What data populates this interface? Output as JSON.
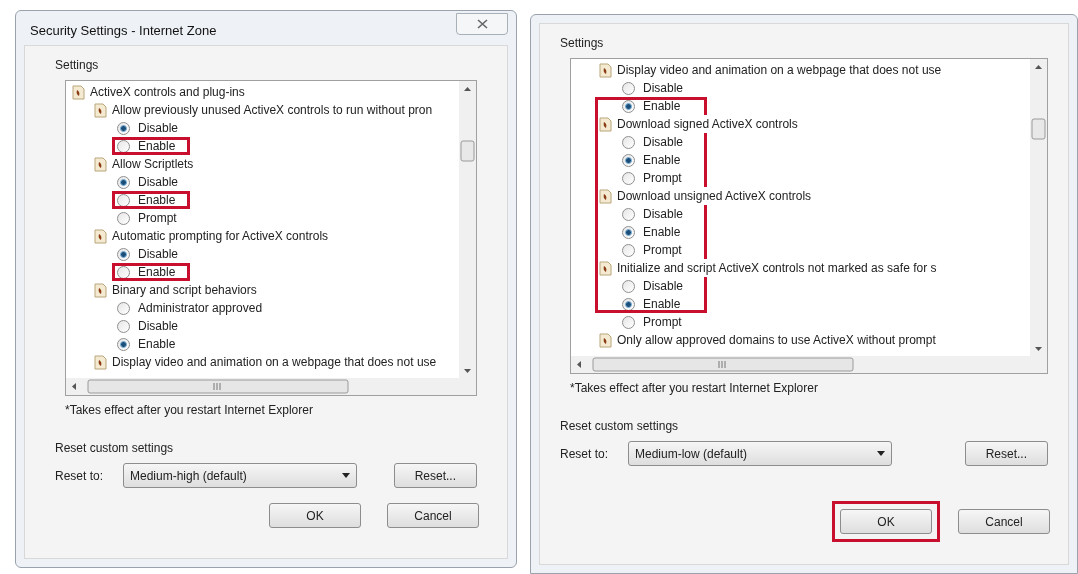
{
  "dialogs": [
    {
      "title": "Security Settings - Internet Zone",
      "settings": {
        "heading": "Settings",
        "tree": [
          {
            "label": "ActiveX controls and plug-ins",
            "highlighted": false,
            "children": [
              {
                "label": "Allow previously unused ActiveX controls to run without pron",
                "highlighted": false,
                "options": [
                  {
                    "label": "Disable",
                    "selected": true,
                    "highlighted": false
                  },
                  {
                    "label": "Enable",
                    "selected": false,
                    "highlighted": true
                  }
                ]
              },
              {
                "label": "Allow Scriptlets",
                "highlighted": false,
                "options": [
                  {
                    "label": "Disable",
                    "selected": true,
                    "highlighted": false
                  },
                  {
                    "label": "Enable",
                    "selected": false,
                    "highlighted": true
                  },
                  {
                    "label": "Prompt",
                    "selected": false,
                    "highlighted": false
                  }
                ]
              },
              {
                "label": "Automatic prompting for ActiveX controls",
                "highlighted": false,
                "options": [
                  {
                    "label": "Disable",
                    "selected": true,
                    "highlighted": false
                  },
                  {
                    "label": "Enable",
                    "selected": false,
                    "highlighted": true
                  }
                ]
              },
              {
                "label": "Binary and script behaviors",
                "highlighted": false,
                "options": [
                  {
                    "label": "Administrator approved",
                    "selected": false,
                    "highlighted": false
                  },
                  {
                    "label": "Disable",
                    "selected": false,
                    "highlighted": false
                  },
                  {
                    "label": "Enable",
                    "selected": true,
                    "highlighted": false
                  }
                ]
              },
              {
                "label": "Display video and animation on a webpage that does not use",
                "highlighted": false
              }
            ]
          }
        ],
        "footnote": "*Takes effect after you restart Internet Explorer"
      },
      "reset": {
        "heading": "Reset custom settings",
        "label": "Reset to:",
        "value": "Medium-high (default)",
        "button": "Reset..."
      },
      "buttons": [
        {
          "label": "OK",
          "highlighted": false
        },
        {
          "label": "Cancel",
          "highlighted": false
        }
      ]
    },
    {
      "settings": {
        "heading": "Settings",
        "tree": [
          {
            "children": [
              {
                "label": "Display video and animation on a webpage that does not use",
                "highlighted": false,
                "options": [
                  {
                    "label": "Disable",
                    "selected": false,
                    "highlighted": false
                  },
                  {
                    "label": "Enable",
                    "selected": true,
                    "highlighted": true
                  }
                ]
              },
              {
                "label": "Download signed ActiveX controls",
                "highlighted": true,
                "options": [
                  {
                    "label": "Disable",
                    "selected": false,
                    "highlighted": true
                  },
                  {
                    "label": "Enable",
                    "selected": true,
                    "highlighted": true
                  },
                  {
                    "label": "Prompt",
                    "selected": false,
                    "highlighted": true
                  }
                ]
              },
              {
                "label": "Download unsigned ActiveX controls",
                "highlighted": true,
                "options": [
                  {
                    "label": "Disable",
                    "selected": false,
                    "highlighted": true
                  },
                  {
                    "label": "Enable",
                    "selected": true,
                    "highlighted": true
                  },
                  {
                    "label": "Prompt",
                    "selected": false,
                    "highlighted": true
                  }
                ]
              },
              {
                "label": "Initialize and script ActiveX controls not marked as safe for s",
                "highlighted": true,
                "options": [
                  {
                    "label": "Disable",
                    "selected": false,
                    "highlighted": true
                  },
                  {
                    "label": "Enable",
                    "selected": true,
                    "highlighted": true
                  },
                  {
                    "label": "Prompt",
                    "selected": false,
                    "highlighted": false
                  }
                ]
              },
              {
                "label": "Only allow approved domains to use ActiveX without prompt",
                "highlighted": false
              }
            ]
          }
        ],
        "footnote": "*Takes effect after you restart Internet Explorer"
      },
      "reset": {
        "heading": "Reset custom settings",
        "label": "Reset to:",
        "value": "Medium-low (default)",
        "button": "Reset..."
      },
      "buttons": [
        {
          "label": "OK",
          "highlighted": true
        },
        {
          "label": "Cancel",
          "highlighted": false
        }
      ]
    }
  ]
}
